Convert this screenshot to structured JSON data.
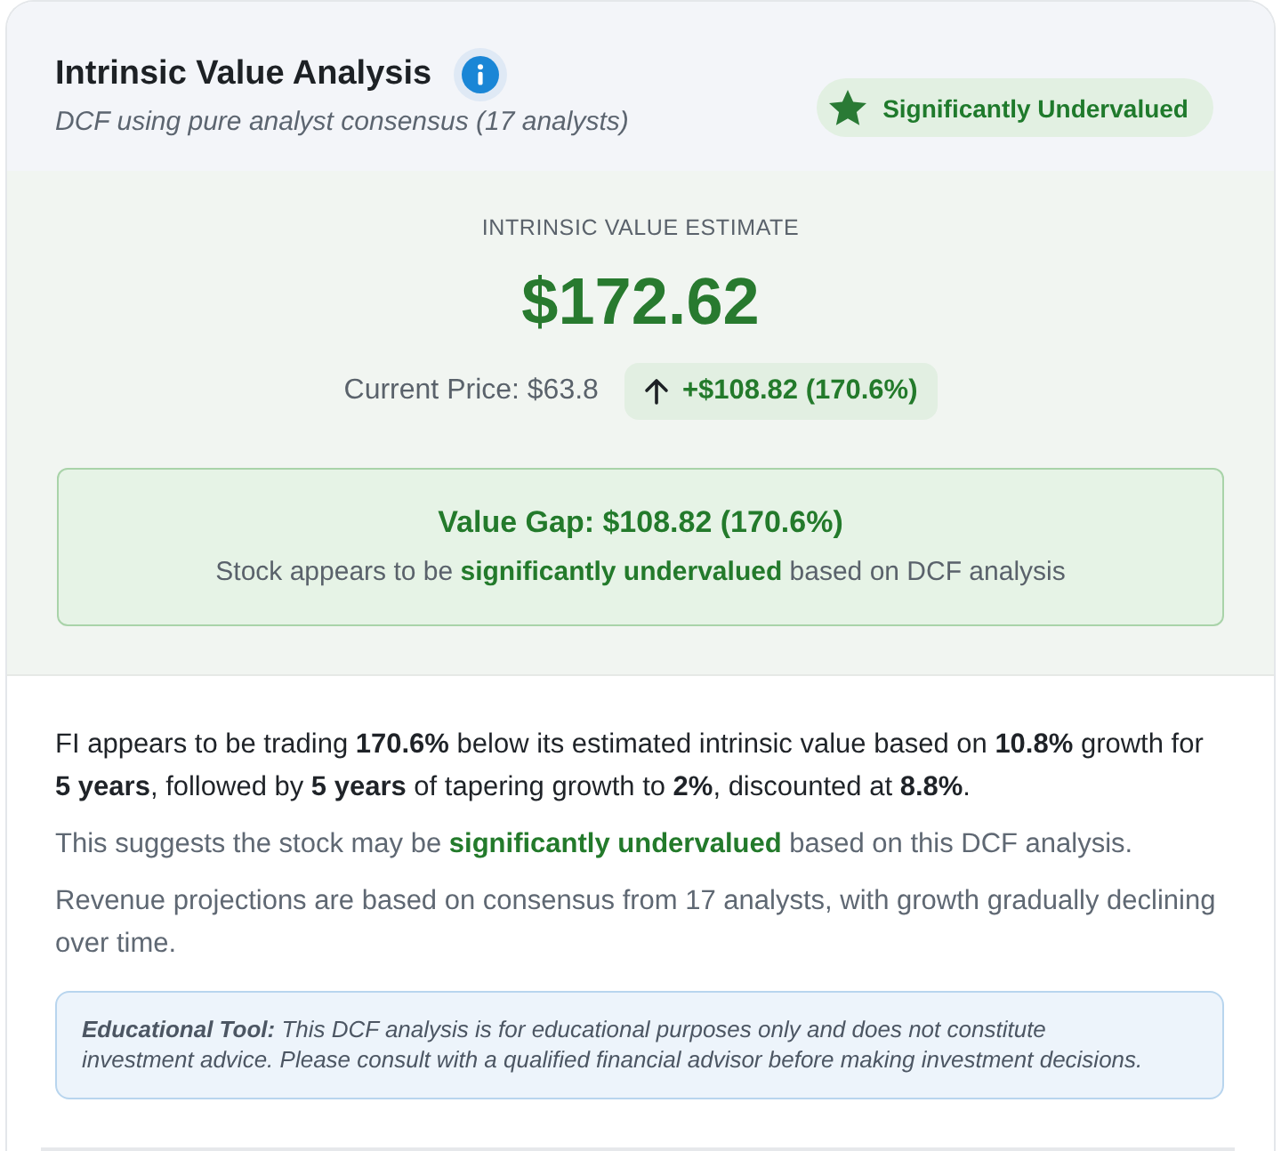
{
  "header": {
    "title": "Intrinsic Value Analysis",
    "subtitle": "DCF using pure analyst consensus (17 analysts)",
    "verdict_badge": {
      "label": "Significantly Undervalued"
    }
  },
  "estimate": {
    "label": "INTRINSIC VALUE ESTIMATE",
    "value": "$172.62",
    "current_price": "Current Price: $63.8",
    "difference": {
      "increase": true,
      "text": "+$108.82 (170.6%)"
    }
  },
  "value_gap": {
    "title": "Value Gap: $108.82 (170.6%)",
    "description": "Stock appears to be **significantly undervalued** based on DCF analysis"
  },
  "summary": [
    {
      "kind": "lead",
      "text": "FI appears to be trading **170.6%** below its estimated intrinsic value based on **10.8%** growth for **5 years**, followed by **5 years** of tapering growth to **2%**, discounted at **8.8%**."
    },
    {
      "kind": "note",
      "text": "This suggests the stock may be **significantly undervalued** based on this DCF analysis."
    },
    {
      "kind": "note",
      "text": "Revenue projections are based on consensus from 17 analysts, with growth gradually declining over time."
    }
  ],
  "disclaimer": "**Educational Tool:** This DCF analysis is for educational purposes only and does not constitute investment advice. Please consult with a qualified financial advisor before making investment decisions."
}
